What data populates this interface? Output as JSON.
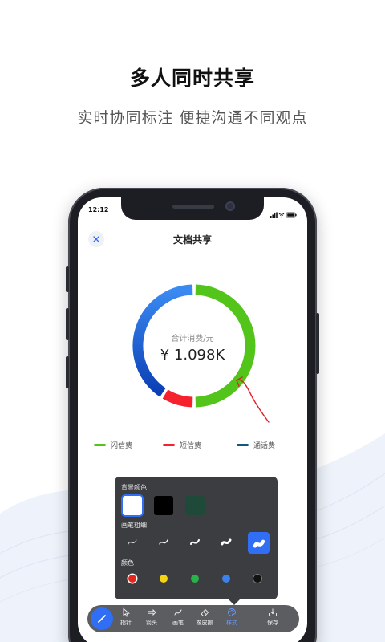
{
  "promo": {
    "headline": "多人同时共享",
    "subline": "实时协同标注  便捷沟通不同观点"
  },
  "status_bar": {
    "time": "12:12"
  },
  "screen": {
    "title": "文档共享"
  },
  "chart_data": {
    "type": "pie",
    "center_label": "合计消费/元",
    "center_value": "¥ 1.098K",
    "categories": [
      "闪信费",
      "短信费",
      "通话费"
    ],
    "series": [
      {
        "name": "闪信费",
        "value": 50,
        "color": "#52c41a"
      },
      {
        "name": "短信费",
        "value": 9,
        "color": "#f5222d"
      },
      {
        "name": "通话费",
        "value": 41,
        "color": "#1e5fd6"
      }
    ]
  },
  "legend": [
    {
      "label": "闪信费",
      "color": "#52c41a"
    },
    {
      "label": "短信费",
      "color": "#f5222d"
    },
    {
      "label": "通话费",
      "color": "#0e5a78"
    }
  ],
  "panel": {
    "bg_color_label": "背景颜色",
    "pen_width_label": "画笔粗细",
    "color_label": "颜色",
    "bg_colors": [
      "#ffffff",
      "#000000",
      "#1f4a3a"
    ],
    "pen_colors": [
      "#e8251c",
      "#f5d315",
      "#27b24a",
      "#3a82f0",
      "#111111"
    ]
  },
  "toolbar": {
    "items": [
      {
        "label": "指针",
        "icon": "pointer-icon"
      },
      {
        "label": "箭头",
        "icon": "arrow-icon"
      },
      {
        "label": "画笔",
        "icon": "pen-icon"
      },
      {
        "label": "橡皮擦",
        "icon": "eraser-icon"
      },
      {
        "label": "样式",
        "icon": "palette-icon"
      },
      {
        "label": "保存",
        "icon": "save-icon"
      }
    ],
    "accent": "#2f6ef5"
  }
}
